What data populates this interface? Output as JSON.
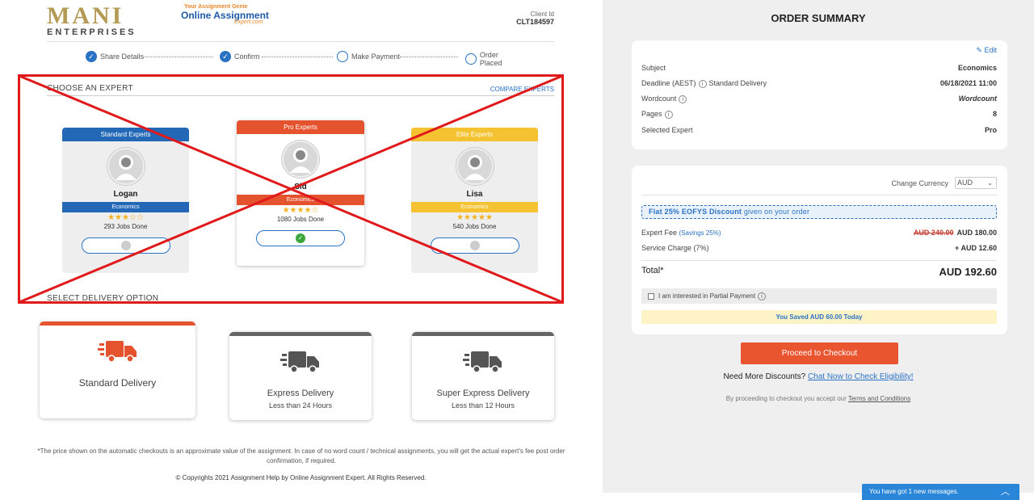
{
  "header": {
    "logo_text": "MANI",
    "logo_sub": "ENTERPRISES",
    "brand_tag": "Your Assignment Genie",
    "brand_name": "Online Assignment",
    "brand_sub": "Expert.com",
    "client_label": "Client Id",
    "client_id": "CLT184597"
  },
  "steps": [
    {
      "label": "Share Details",
      "state": "done"
    },
    {
      "label": "Confirm",
      "state": "done"
    },
    {
      "label": "Make Payment",
      "state": "todo"
    },
    {
      "label": "Order Placed",
      "state": "todo"
    }
  ],
  "expert_section": {
    "title": "CHOOSE AN EXPERT",
    "compare": "COMPARE EXPERTS",
    "cards": [
      {
        "tier": "Standard Experts",
        "name": "Logan",
        "subject": "Economics",
        "rating": 3,
        "jobs": "293 Jobs Done",
        "selected": false,
        "color": "#2368b7"
      },
      {
        "tier": "Pro Experts",
        "name": "Sid",
        "subject": "Economics",
        "rating": 4,
        "jobs": "1080 Jobs Done",
        "selected": true,
        "color": "#e5532e"
      },
      {
        "tier": "Elite Experts",
        "name": "Lisa",
        "subject": "Economics",
        "rating": 5,
        "jobs": "540 Jobs Done",
        "selected": false,
        "color": "#f5c331"
      }
    ]
  },
  "delivery_section": {
    "title": "SELECT DELIVERY OPTION",
    "options": [
      {
        "title": "Standard Delivery",
        "sub": "",
        "selected": true
      },
      {
        "title": "Express Delivery",
        "sub": "Less than 24 Hours",
        "selected": false
      },
      {
        "title": "Super Express Delivery",
        "sub": "Less than 12 Hours",
        "selected": false
      }
    ]
  },
  "footer": {
    "disclaimer": "*The price shown on the automatic checkouts is an approximate value of the assignment. In case of no word count / technical assignments, you will get the actual expert's fee post order confirmation, if required.",
    "copyright": "© Copyrights 2021 Assignment Help by Online Assignment Expert. All Rights Reserved."
  },
  "summary": {
    "title": "ORDER SUMMARY",
    "edit": "Edit",
    "rows": [
      {
        "label": "Subject",
        "value": "Economics"
      },
      {
        "label": "Deadline (AEST)",
        "extra": "Standard Delivery",
        "value": "06/18/2021 11:00"
      },
      {
        "label": "Wordcount",
        "value": "Wordcount"
      },
      {
        "label": "Pages",
        "value": "8"
      },
      {
        "label": "Selected Expert",
        "value": "Pro"
      }
    ],
    "currency_label": "Change Currency",
    "currency": "AUD",
    "discount_bold": "Flat 25% EOFYS Discount",
    "discount_rest": "given on your order",
    "expert_fee_label": "Expert Fee",
    "expert_fee_savings": "(Savings 25%)",
    "expert_fee_old": "AUD 240.00",
    "expert_fee_new": "AUD 180.00",
    "service_label": "Service Charge (7%)",
    "service_value": "+ AUD 12.60",
    "total_label": "Total*",
    "total_value": "AUD 192.60",
    "partial_label": "I am interested in Partial Payment",
    "saved": "You Saved AUD 60.00 Today",
    "checkout": "Proceed to Checkout",
    "need_text": "Need More Discounts?",
    "need_link": "Chat Now to Check Eligibility!",
    "accept_text": "By proceeding to checkout you accept our",
    "accept_link": "Terms and Conditions"
  },
  "chat": {
    "text": "You have got 1 new messages."
  }
}
